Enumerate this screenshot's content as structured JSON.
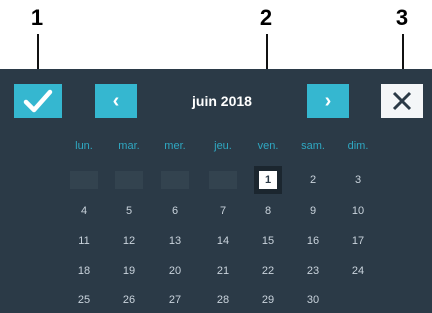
{
  "callouts": [
    "1",
    "2",
    "3"
  ],
  "header": {
    "month_label": "juin 2018",
    "confirm_icon": "check-icon",
    "prev_icon": "chevron-left-icon",
    "next_icon": "chevron-right-icon",
    "close_icon": "close-icon",
    "prev_glyph": "‹",
    "next_glyph": "›"
  },
  "weekdays": [
    "lun.",
    "mar.",
    "mer.",
    "jeu.",
    "ven.",
    "sam.",
    "dim."
  ],
  "weeks": [
    [
      "",
      "",
      "",
      "",
      "1",
      "2",
      "3"
    ],
    [
      "4",
      "5",
      "6",
      "7",
      "8",
      "9",
      "10"
    ],
    [
      "11",
      "12",
      "13",
      "14",
      "15",
      "16",
      "17"
    ],
    [
      "18",
      "19",
      "20",
      "21",
      "22",
      "23",
      "24"
    ],
    [
      "25",
      "26",
      "27",
      "28",
      "29",
      "30",
      ""
    ]
  ],
  "selected_day": "1",
  "colors": {
    "panel": "#2b3a47",
    "accent": "#35b7d0",
    "weekday_text": "#2fa8c2",
    "day_text": "#c9d3dc"
  }
}
